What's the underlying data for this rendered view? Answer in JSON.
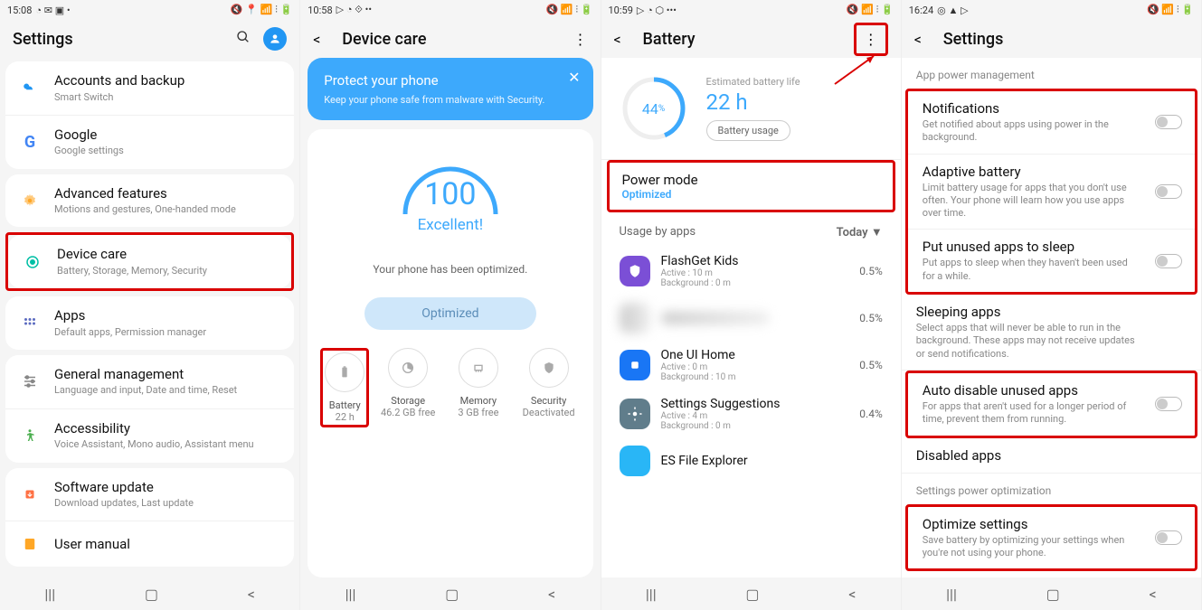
{
  "screen1": {
    "time": "15:08",
    "title": "Settings",
    "items": [
      {
        "title": "Accounts and backup",
        "sub": "Smart Switch"
      },
      {
        "title": "Google",
        "sub": "Google settings"
      },
      {
        "title": "Advanced features",
        "sub": "Motions and gestures, One-handed mode"
      },
      {
        "title": "Device care",
        "sub": "Battery, Storage, Memory, Security"
      },
      {
        "title": "Apps",
        "sub": "Default apps, Permission manager"
      },
      {
        "title": "General management",
        "sub": "Language and input, Date and time, Reset"
      },
      {
        "title": "Accessibility",
        "sub": "Voice Assistant, Mono audio, Assistant menu"
      },
      {
        "title": "Software update",
        "sub": "Download updates, Last update"
      },
      {
        "title": "User manual",
        "sub": ""
      }
    ]
  },
  "screen2": {
    "time": "10:58",
    "title": "Device care",
    "banner": {
      "title": "Protect your phone",
      "sub": "Keep your phone safe from malware with Security."
    },
    "score": "100",
    "score_label": "Excellent!",
    "optimized_text": "Your phone has been optimized.",
    "btn": "Optimized",
    "tiles": [
      {
        "label": "Battery",
        "val": "22 h"
      },
      {
        "label": "Storage",
        "val": "46.2 GB free"
      },
      {
        "label": "Memory",
        "val": "3 GB free"
      },
      {
        "label": "Security",
        "val": "Deactivated"
      }
    ]
  },
  "screen3": {
    "time": "10:59",
    "title": "Battery",
    "pct": "44",
    "pct_suffix": "%",
    "est_label": "Estimated battery life",
    "life": "22 h",
    "usage_btn": "Battery usage",
    "powermode": {
      "title": "Power mode",
      "val": "Optimized"
    },
    "usage_hdr": "Usage by apps",
    "today": "Today",
    "apps": [
      {
        "name": "FlashGet Kids",
        "active": "Active : 10 m",
        "bg": "Background : 0 m",
        "pct": "0.5%"
      },
      {
        "name": "",
        "active": "",
        "bg": "",
        "pct": "0.5%"
      },
      {
        "name": "One UI Home",
        "active": "Active : 0 m",
        "bg": "Background : 10 m",
        "pct": "0.5%"
      },
      {
        "name": "Settings Suggestions",
        "active": "Active : 4 m",
        "bg": "Background : 0 m",
        "pct": "0.4%"
      },
      {
        "name": "ES File Explorer",
        "active": "",
        "bg": "",
        "pct": ""
      }
    ]
  },
  "screen4": {
    "time": "16:24",
    "title": "Settings",
    "section1": "App power management",
    "rows": [
      {
        "title": "Notifications",
        "sub": "Get notified about apps using power in the background."
      },
      {
        "title": "Adaptive battery",
        "sub": "Limit battery usage for apps that you don't use often. Your phone will learn how you use apps over time."
      },
      {
        "title": "Put unused apps to sleep",
        "sub": "Put apps to sleep when they haven't been used for a while."
      }
    ],
    "sleeping": {
      "title": "Sleeping apps",
      "sub": "Select apps that will never be able to run in the background. These apps may not receive updates or send notifications."
    },
    "auto": {
      "title": "Auto disable unused apps",
      "sub": "For apps that aren't used for a longer period of time, prevent them from running."
    },
    "disabled": {
      "title": "Disabled apps"
    },
    "section2": "Settings power optimization",
    "optimize": {
      "title": "Optimize settings",
      "sub": "Save battery by optimizing your settings when you're not using your phone."
    }
  }
}
